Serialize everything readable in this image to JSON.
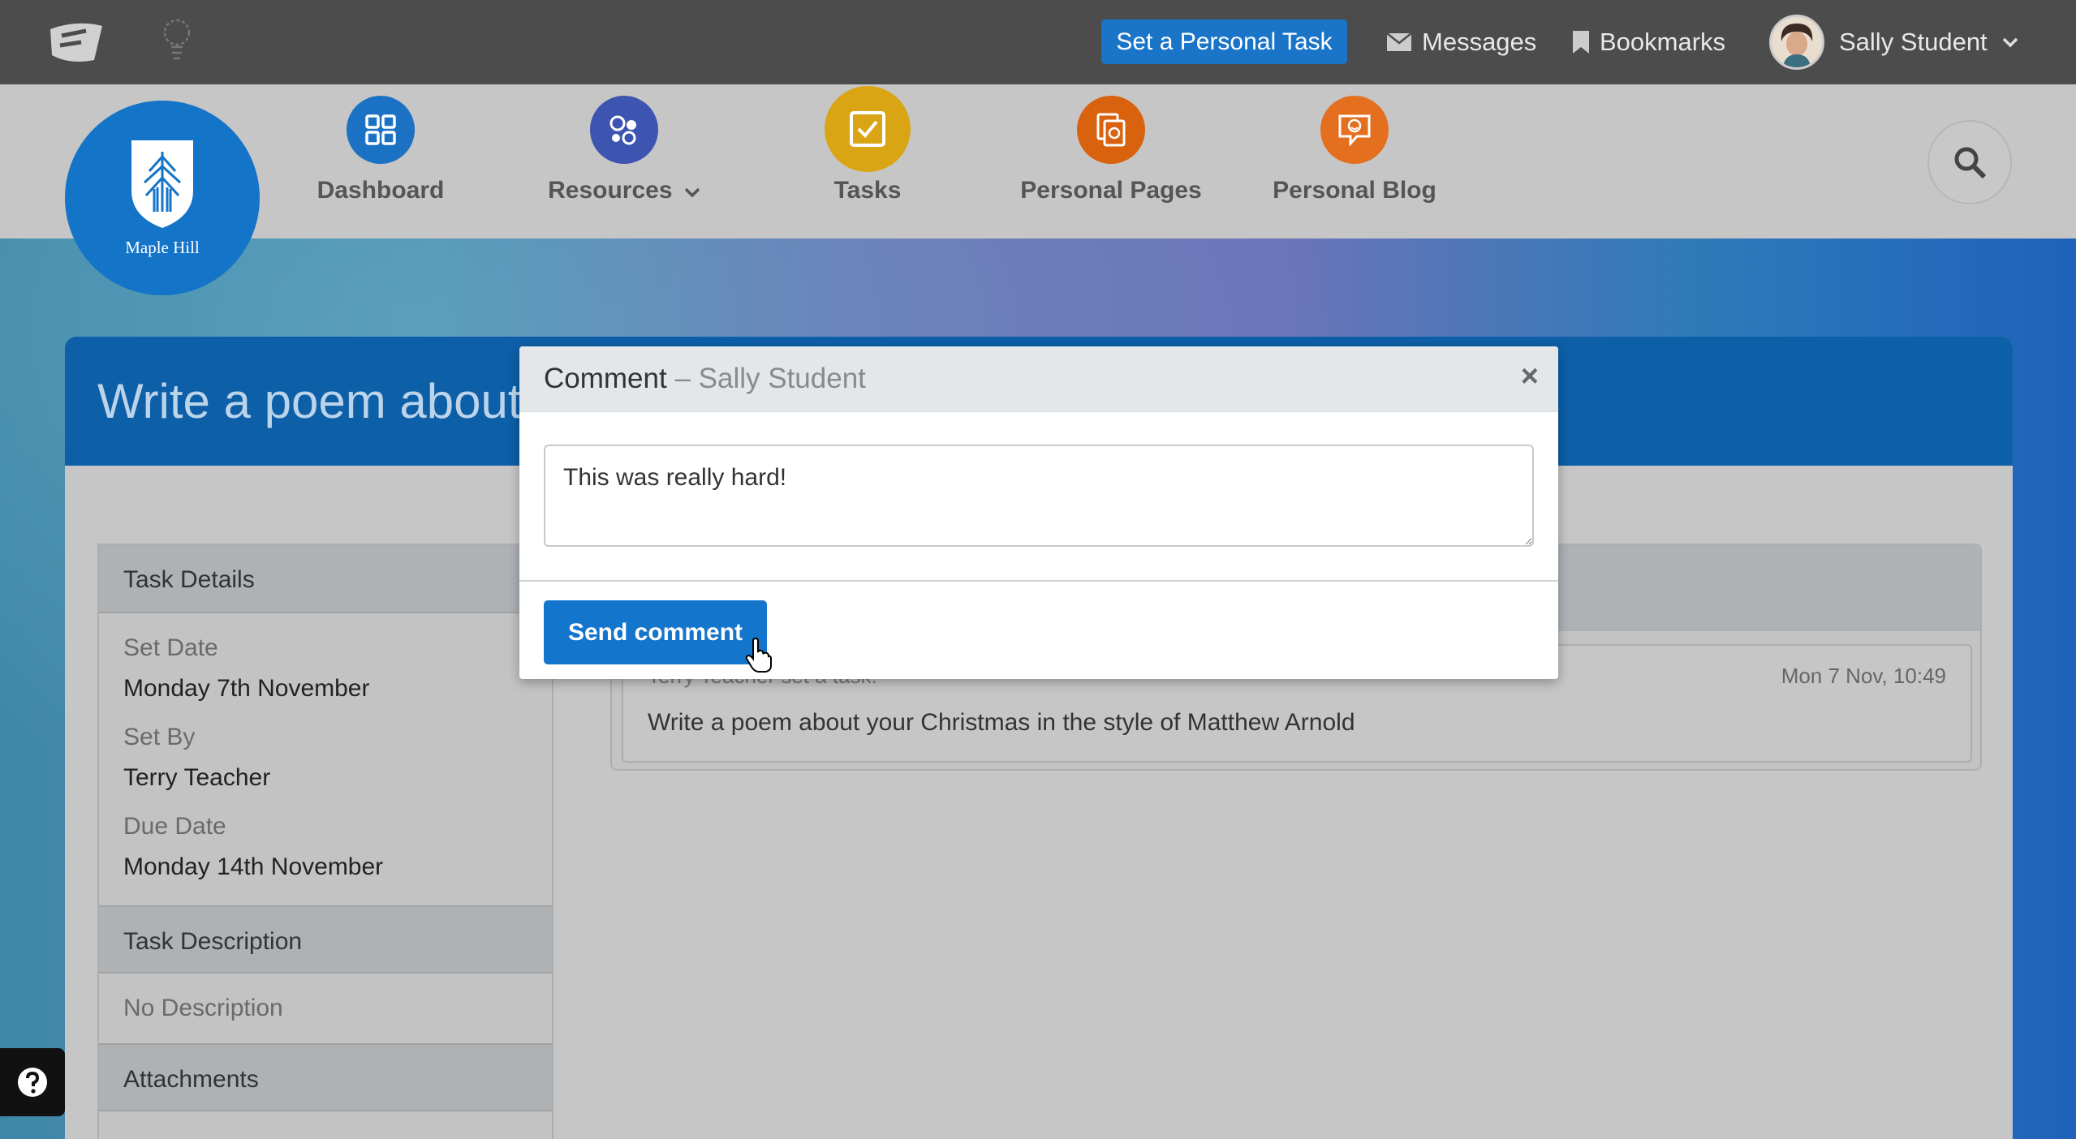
{
  "topbar": {
    "set_task_button": "Set a Personal Task",
    "messages_label": "Messages",
    "bookmarks_label": "Bookmarks",
    "user_name": "Sally Student"
  },
  "school": {
    "name": "Maple Hill"
  },
  "nav": {
    "items": [
      {
        "label": "Dashboard",
        "color": "#1b72c4",
        "icon": "grid-icon"
      },
      {
        "label": "Resources",
        "color": "#3d54b0",
        "icon": "bubbles-icon"
      },
      {
        "label": "Tasks",
        "color": "#d9a514",
        "icon": "checkbox-icon"
      },
      {
        "label": "Personal Pages",
        "color": "#d9620f",
        "icon": "pages-icon"
      },
      {
        "label": "Personal Blog",
        "color": "#e36f1f",
        "icon": "blog-icon"
      }
    ]
  },
  "page": {
    "title": "Write a poem about"
  },
  "task_details": {
    "heading": "Task Details",
    "set_date_label": "Set Date",
    "set_date": "Monday 7th November",
    "set_by_label": "Set By",
    "set_by": "Terry Teacher",
    "due_date_label": "Due Date",
    "due_date": "Monday 14th November",
    "description_heading": "Task Description",
    "description": "No Description",
    "attachments_heading": "Attachments"
  },
  "activity": {
    "meta": "Terry Teacher set a task:",
    "time": "Mon 7 Nov, 10:49",
    "text": "Write a poem about your Christmas in the style of Matthew Arnold"
  },
  "modal": {
    "title": "Comment",
    "subtitle": "– Sally Student",
    "comment_value": "This was really hard!",
    "send_button": "Send comment"
  },
  "colors": {
    "topbar": "#4c4c4c",
    "primary": "#1475cc",
    "header": "#0d5fa8"
  }
}
